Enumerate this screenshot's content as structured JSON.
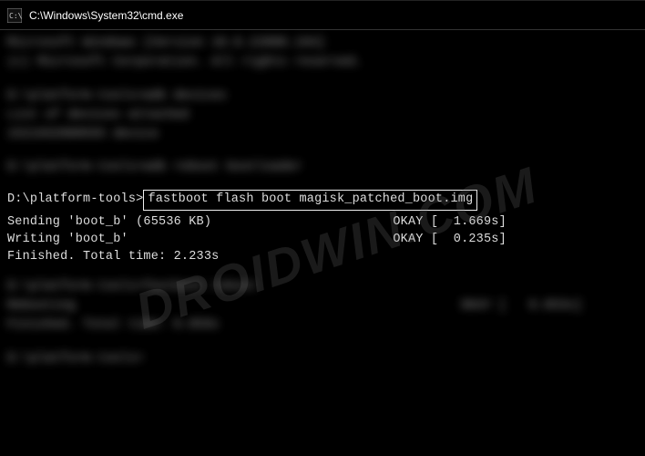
{
  "titlebar": {
    "path": "C:\\Windows\\System32\\cmd.exe"
  },
  "blurred_sections": {
    "s1_line1": "Microsoft Windows [Version 10.0.22000.194]",
    "s1_line2": "(c) Microsoft Corporation. All rights reserved.",
    "s2_line1": "D:\\platform-tools>adb devices",
    "s2_line2": "List of devices attached",
    "s2_line3": "1521932800555   device",
    "s3_line1": "D:\\platform-tools>adb reboot bootloader",
    "s4_line1": "D:\\platform-tools>fastboot reboot",
    "s4_line2": "Rebooting",
    "s4_okay": "                                                   OKAY [   0.053s]",
    "s4_line3": "Finished. Total time: 0.059s",
    "s5_line1": "D:\\platform-tools>"
  },
  "clear": {
    "prompt": "D:\\platform-tools>",
    "command": "fastboot flash boot magisk_patched_boot.img",
    "out1": "Sending 'boot_b' (65536 KB)                        OKAY [  1.669s]",
    "out2": "Writing 'boot_b'                                   OKAY [  0.235s]",
    "out3": "Finished. Total time: 2.233s"
  },
  "watermark": "DROIDWIN.COM"
}
